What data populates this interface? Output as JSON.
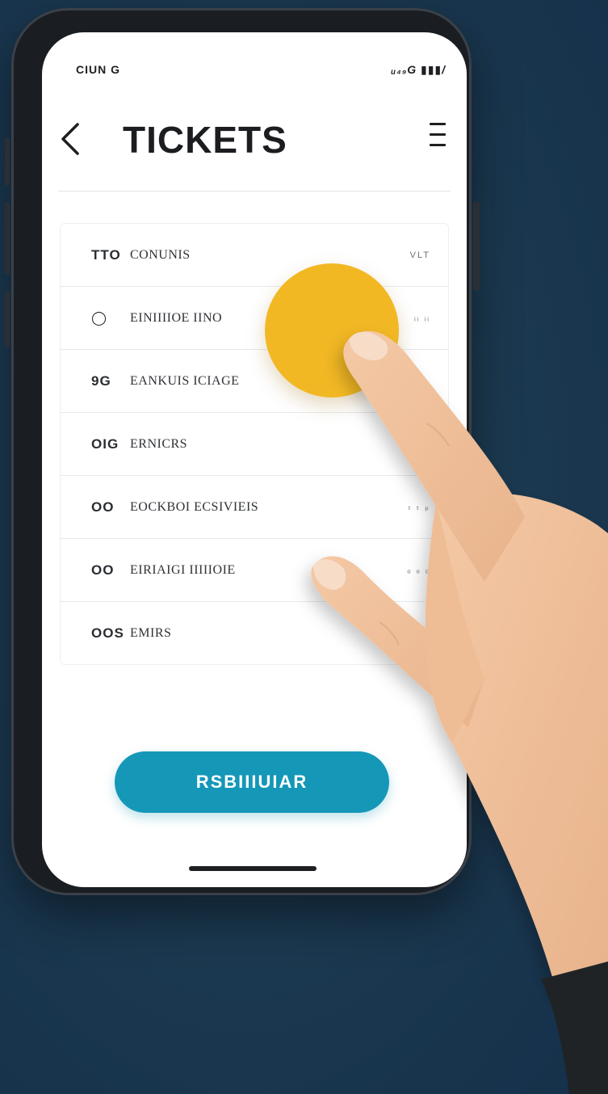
{
  "status_bar": {
    "time": "CIUN G",
    "indicators": "ᵤ₄₉G ▮▮▮/"
  },
  "header": {
    "back_icon": "chevron-left-icon",
    "title": "TICKETS",
    "menu_icon": "menu-icon"
  },
  "tickets": [
    {
      "num": "TTO",
      "name": "CONUNIS",
      "meta": "VLT"
    },
    {
      "num": "◯",
      "name": "EINIIIIOE IINO",
      "meta": "ᵢᵢ ᵢᵢ"
    },
    {
      "num": "9G",
      "name": "EANKUIS ICIAGE",
      "meta": ""
    },
    {
      "num": "OIG",
      "name": "ERNICRS",
      "meta": ""
    },
    {
      "num": "OO",
      "name": "EOCKBOI ECSIVIEIS",
      "meta": "ₜ ₜ ₚ"
    },
    {
      "num": "OO",
      "name": "EIRIAIGI IIIIIOIE",
      "meta": "ₒ ₒ ₒ"
    },
    {
      "num": "OOS",
      "name": "EMIRS",
      "meta": ""
    }
  ],
  "cta_label": "RSBIIIUIAR",
  "colors": {
    "accent": "#1597b8",
    "touch_indicator": "#f2b824",
    "background": "#1c3a51",
    "skin": "#f2c5a0"
  }
}
